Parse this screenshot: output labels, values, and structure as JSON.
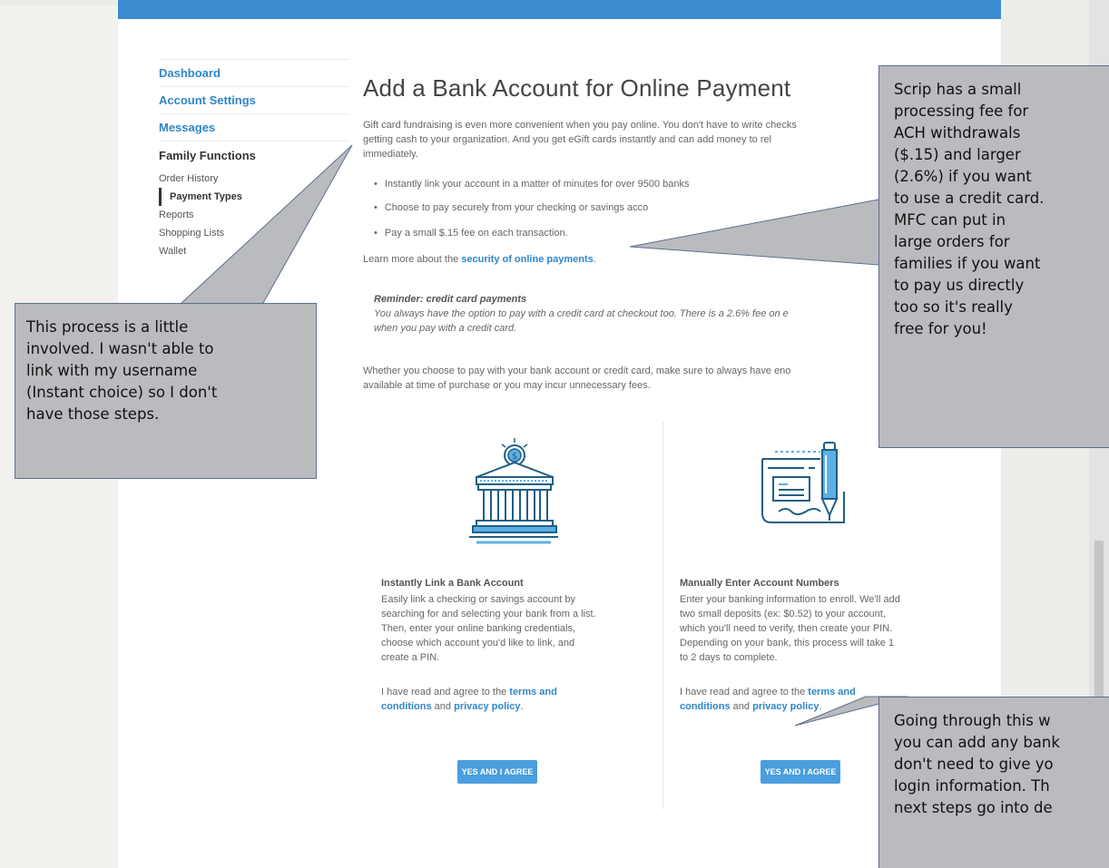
{
  "sidebar": {
    "links": [
      "Dashboard",
      "Account Settings",
      "Messages"
    ],
    "section_head": "Family Functions",
    "sub_items": [
      "Order History",
      "Payment Types",
      "Reports",
      "Shopping Lists",
      "Wallet"
    ],
    "active_item": "Payment Types"
  },
  "main": {
    "title": "Add a Bank Account for Online Payment",
    "intro_line1": "Gift card fundraising is even more convenient when you pay online. You don't have to write checks",
    "intro_line2": "getting cash to your organization. And you get eGift cards instantly and can add money to rel",
    "intro_line3": "immediately.",
    "bullets": [
      "Instantly link your account in a matter of minutes for over 9500 banks",
      "Choose to pay securely from your checking or savings acco",
      "Pay a small $.15 fee on each transaction."
    ],
    "learn_prefix": "Learn more about the",
    "learn_link": "security of online payments",
    "learn_suffix": ".",
    "reminder_title": "Reminder: credit card payments",
    "reminder_line1": "You always have the option to pay with a credit card at checkout too. There is a 2.6% fee on e",
    "reminder_line2": "when you pay with a credit card.",
    "whether_line1": "Whether you choose to pay with your bank account or credit card, make sure to always have eno",
    "whether_line2": "available at time of purchase or you may incur unnecessary fees."
  },
  "options": [
    {
      "title": "Instantly Link a Bank Account",
      "lines": [
        "Easily link a checking or savings account by",
        "searching for and selecting your bank from a list.",
        "Then, enter your online banking credentials,",
        "choose which account you'd like to link, and",
        "create a PIN."
      ],
      "agree_prefix": "I have read and agree to the",
      "terms_a": "terms and",
      "terms_b": "conditions",
      "and_text": "and",
      "privacy": "privacy policy",
      "period": ".",
      "button": "YES AND I AGREE"
    },
    {
      "title": "Manually Enter Account Numbers",
      "lines": [
        "Enter your banking information to enroll. We'll add",
        "two small deposits (ex: $0.52) to your account,",
        "which you'll need to verify, then create your PIN.",
        "Depending on your bank, this process will take 1",
        "to 2 days to complete."
      ],
      "agree_prefix": "I have read and agree to the",
      "terms_a": "terms and",
      "terms_b": "conditions",
      "and_text": "and",
      "privacy": "privacy policy",
      "period": ".",
      "button": "YES AND I AGREE"
    }
  ],
  "callouts": {
    "left": [
      "This process is a little",
      "involved.  I wasn't able to",
      "link with my username",
      "(Instant choice) so I don't",
      "have those steps."
    ],
    "right": [
      "Scrip has a small",
      "processing fee for",
      "ACH withdrawals",
      "($.15) and larger",
      "(2.6%) if you want",
      "to use a credit card.",
      "MFC can put in",
      "large orders for",
      "families if you want",
      "to pay us directly",
      "too so it's really",
      "free for you!"
    ],
    "bottom": [
      "Going through this w",
      "you can add any bank",
      "don't need to give yo",
      "login information.  Th",
      "next steps go into de"
    ]
  },
  "colors": {
    "accent": "#2f86c9",
    "topbar": "#3b8bd0",
    "button": "#4a9ede",
    "callout_fill": "#b9bbbe",
    "callout_border": "#5e6f8c"
  }
}
